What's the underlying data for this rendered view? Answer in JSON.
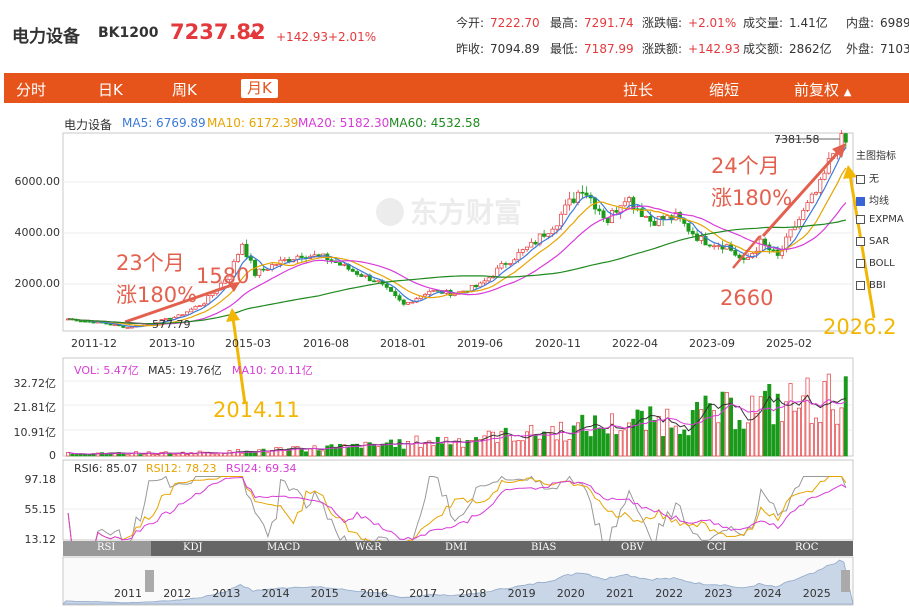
{
  "header": {
    "name": "电力设备",
    "code": "BK1200",
    "price": "7237.82",
    "change": "+142.93",
    "change_pct": "+2.01%",
    "stats": [
      {
        "label": "今开:",
        "value": "7222.70",
        "red": true
      },
      {
        "label": "最高:",
        "value": "7291.74",
        "red": true
      },
      {
        "label": "涨跌幅:",
        "value": "+2.01%",
        "red": true
      },
      {
        "label": "成交量:",
        "value": "1.41亿",
        "red": false
      },
      {
        "label": "内盘:",
        "value": "6989",
        "red": false
      },
      {
        "label": "昨收:",
        "value": "7094.89",
        "red": false
      },
      {
        "label": "最低:",
        "value": "7187.99",
        "red": true
      },
      {
        "label": "涨跌额:",
        "value": "+142.93",
        "red": true
      },
      {
        "label": "成交额:",
        "value": "2862亿",
        "red": false
      },
      {
        "label": "外盘:",
        "value": "7103",
        "red": false
      }
    ]
  },
  "tabs": [
    "分时",
    "日K",
    "周K",
    "月K"
  ],
  "active_tab": "月K",
  "tools": [
    "拉长",
    "缩短",
    "前复权"
  ],
  "ma_legend": {
    "name": "电力设备",
    "ma5": "MA5: 6769.89",
    "ma10": "MA10: 6172.39",
    "ma20": "MA20: 5182.30",
    "ma60": "MA60: 4532.58"
  },
  "colors": {
    "ma5": "#3b7ad9",
    "ma10": "#e6a400",
    "ma20": "#d93bd9",
    "ma60": "#1f8a1f",
    "up": "#e4393c",
    "down": "#1a9a1a",
    "nav": "#e6541b",
    "annotation_red": "#e4604e",
    "annotation_yellow": "#f2b705"
  },
  "price_axis": [
    "6000.00",
    "4000.00",
    "2000.00"
  ],
  "x_axis": [
    "2011-12",
    "2013-10",
    "2015-03",
    "2016-08",
    "2018-01",
    "2019-06",
    "2020-11",
    "2022-04",
    "2023-09",
    "2025-02"
  ],
  "price_marks": {
    "high": "7381.58",
    "low": "577.79"
  },
  "side_panel": {
    "title": "主图指标",
    "items": [
      {
        "label": "无",
        "checked": false
      },
      {
        "label": "均线",
        "checked": true
      },
      {
        "label": "EXPMA",
        "checked": false
      },
      {
        "label": "SAR",
        "checked": false
      },
      {
        "label": "BOLL",
        "checked": false
      },
      {
        "label": "BBI",
        "checked": false
      }
    ]
  },
  "annotations": {
    "left_period": "23个月",
    "left_gain": "涨180%",
    "left_value": "1580",
    "left_date": "2014.11",
    "right_period": "24个月",
    "right_gain": "涨180%",
    "right_value": "2660",
    "right_date": "2026.2"
  },
  "vol_legend": {
    "vol": "VOL: 5.47亿",
    "ma5": "MA5: 19.76亿",
    "ma10": "MA10: 20.11亿"
  },
  "vol_axis": [
    "32.72亿",
    "21.81亿",
    "10.91亿",
    "0"
  ],
  "rsi_legend": {
    "rsi6": "RSI6: 85.07",
    "rsi12": "RSI12: 78.23",
    "rsi24": "RSI24: 69.34"
  },
  "rsi_axis": [
    "97.18",
    "55.15",
    "13.12"
  ],
  "indicator_tabs": [
    "RSI",
    "KDJ",
    "MACD",
    "W&R",
    "DMI",
    "BIAS",
    "OBV",
    "CCI",
    "ROC"
  ],
  "navigator_years": [
    "2011",
    "2012",
    "2013",
    "2014",
    "2015",
    "2016",
    "2017",
    "2018",
    "2019",
    "2020",
    "2021",
    "2022",
    "2023",
    "2024",
    "2025"
  ],
  "watermark": "东方财富"
}
